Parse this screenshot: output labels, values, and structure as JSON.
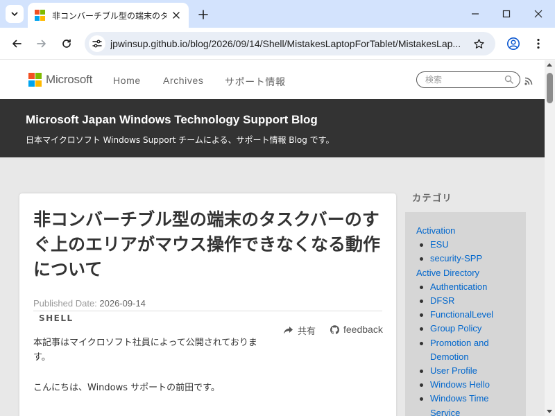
{
  "browser": {
    "tab": {
      "title": "非コンバーチブル型の端末のタスクバ"
    },
    "url": "jpwinsup.github.io/blog/2026/09/14/Shell/MistakesLaptopForTablet/MistakesLap...",
    "icons": {
      "tab_search": "chevron-down-icon",
      "tab_close": "close-icon",
      "new_tab": "plus-icon",
      "minimize": "minimize-icon",
      "maximize": "maximize-icon",
      "close": "close-icon",
      "back": "back-arrow-icon",
      "forward": "forward-arrow-icon",
      "reload": "reload-icon",
      "site_info": "tune-icon",
      "bookmark": "star-icon",
      "profile": "profile-icon",
      "menu": "kebab-menu-icon"
    }
  },
  "site": {
    "brand": "Microsoft",
    "nav": [
      {
        "label": "Home"
      },
      {
        "label": "Archives"
      },
      {
        "label": "サポート情報"
      }
    ],
    "search_placeholder": "検索",
    "banner_title": "Microsoft Japan Windows Technology Support Blog",
    "banner_subtitle": "日本マイクロソフト Windows Support チームによる、サポート情報 Blog です。"
  },
  "article": {
    "title": "非コンバーチブル型の端末のタスクバーのすぐ上のエリアがマウス操作できなくなる動作について",
    "published_label": "Published Date:",
    "published_date": "2026-09-14",
    "tag": "SHELL",
    "share_label": "共有",
    "feedback_label": "feedback",
    "paragraphs": [
      "本記事はマイクロソフト社員によって公開されております。",
      "こんにちは、Windows サポートの前田です。"
    ]
  },
  "sidebar": {
    "heading": "カテゴリ",
    "categories": [
      {
        "label": "Activation",
        "level": 0
      },
      {
        "label": "ESU",
        "level": 1
      },
      {
        "label": "security-SPP",
        "level": 1
      },
      {
        "label": "Active Directory",
        "level": 0
      },
      {
        "label": "Authentication",
        "level": 1
      },
      {
        "label": "DFSR",
        "level": 1
      },
      {
        "label": "FunctionalLevel",
        "level": 1
      },
      {
        "label": "Group Policy",
        "level": 1
      },
      {
        "label": "Promotion and Demotion",
        "level": 1
      },
      {
        "label": "User Profile",
        "level": 1
      },
      {
        "label": "Windows Hello",
        "level": 1
      },
      {
        "label": "Windows Time Service",
        "level": 1
      }
    ]
  },
  "colors": {
    "tabstrip": "#d3e3fd",
    "banner": "#333333",
    "link": "#0066cc",
    "ms_red": "#f25022",
    "ms_green": "#7fba00",
    "ms_blue": "#00a4ef",
    "ms_yellow": "#ffb900"
  }
}
